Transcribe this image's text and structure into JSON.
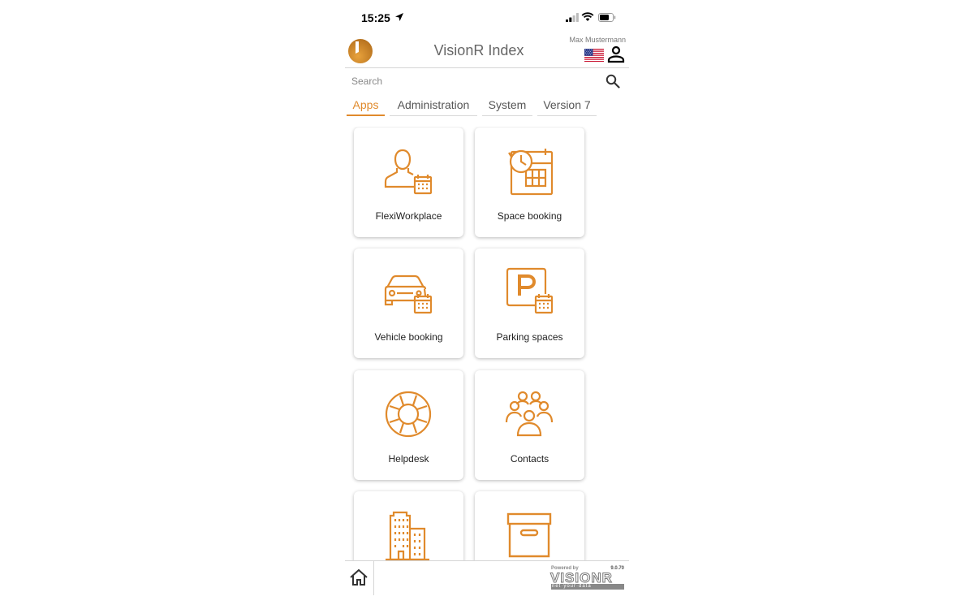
{
  "status_bar": {
    "time": "15:25"
  },
  "header": {
    "title": "VisionR Index",
    "username": "Max Mustermann"
  },
  "search": {
    "placeholder": "Search"
  },
  "tabs": [
    {
      "label": "Apps",
      "active": true
    },
    {
      "label": "Administration",
      "active": false
    },
    {
      "label": "System",
      "active": false
    },
    {
      "label": "Version 7",
      "active": false
    }
  ],
  "tiles": [
    {
      "label": "FlexiWorkplace",
      "icon": "person-calendar-icon"
    },
    {
      "label": "Space booking",
      "icon": "clock-calendar-icon"
    },
    {
      "label": "Vehicle booking",
      "icon": "car-calendar-icon"
    },
    {
      "label": "Parking spaces",
      "icon": "parking-calendar-icon"
    },
    {
      "label": "Helpdesk",
      "icon": "lifebuoy-icon"
    },
    {
      "label": "Contacts",
      "icon": "group-icon"
    },
    {
      "label": "",
      "icon": "buildings-icon"
    },
    {
      "label": "",
      "icon": "archive-box-icon"
    }
  ],
  "footer": {
    "powered_by": "Powered by",
    "brand": "VISIONR",
    "tagline": "net·your·data",
    "version": "9.0.70"
  },
  "colors": {
    "accent": "#e08a2c",
    "text": "#222222",
    "muted": "#666666"
  }
}
